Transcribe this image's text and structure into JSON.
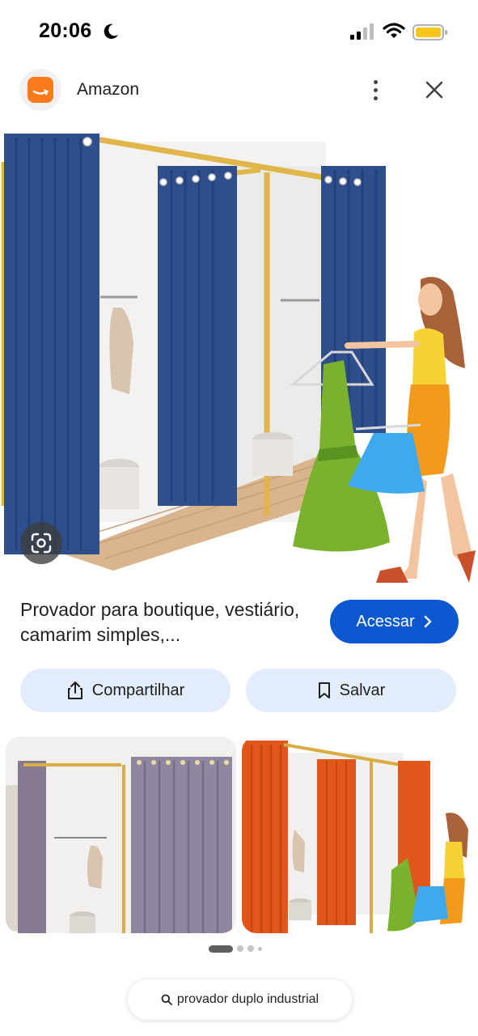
{
  "status_bar": {
    "time": "20:06",
    "icons": [
      "moon-icon",
      "signal-icon",
      "wifi-icon",
      "battery-icon"
    ],
    "battery_color": "#f5c518"
  },
  "header": {
    "site_name": "Amazon",
    "logo_color": "#ff7a1a",
    "icons": [
      "more-vert-icon",
      "close-icon"
    ]
  },
  "product": {
    "title": "Provador para boutique, vestiário, camarim simples,...",
    "visit_label": "Acessar",
    "visit_icon": "chevron-right-icon",
    "accent_color": "#0b57d0"
  },
  "actions": {
    "share_label": "Compartilhar",
    "share_icon": "share-icon",
    "save_label": "Salvar",
    "save_icon": "bookmark-icon",
    "button_color": "#e3ecfb"
  },
  "related": {
    "images": [
      {
        "name": "related-image-gray-curtains",
        "curtain_color": "#8c7f96"
      },
      {
        "name": "related-image-orange-curtains",
        "curtain_color": "#e0561b"
      }
    ]
  },
  "pagination": {
    "count": 4,
    "active_index": 0
  },
  "search_chip": {
    "label": "provador duplo industrial",
    "icon": "search-icon"
  }
}
